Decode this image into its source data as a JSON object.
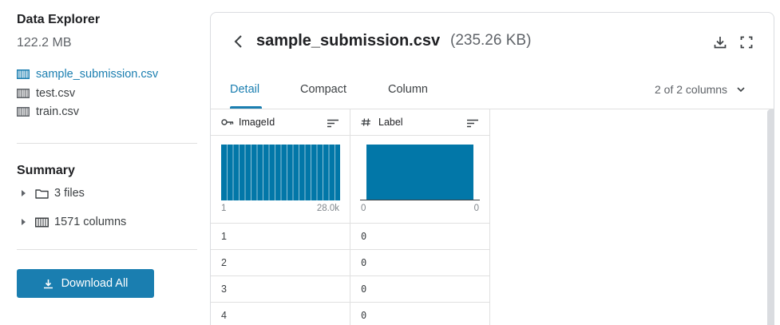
{
  "sidebar": {
    "title": "Data Explorer",
    "size": "122.2 MB",
    "files": [
      {
        "name": "sample_submission.csv",
        "active": true
      },
      {
        "name": "test.csv",
        "active": false
      },
      {
        "name": "train.csv",
        "active": false
      }
    ],
    "summary": {
      "title": "Summary",
      "items": [
        {
          "label": "3 files",
          "icon": "folder-icon"
        },
        {
          "label": "1571 columns",
          "icon": "table-icon"
        }
      ]
    },
    "download_all_label": "Download All"
  },
  "panel": {
    "file_title": "sample_submission.csv",
    "file_size": "(235.26 KB)",
    "tabs": [
      {
        "label": "Detail",
        "active": true
      },
      {
        "label": "Compact",
        "active": false
      },
      {
        "label": "Column",
        "active": false
      }
    ],
    "column_count": "2 of 2 columns",
    "columns": [
      {
        "name": "ImageId",
        "type_icon": "key-icon",
        "hist_min": "1",
        "hist_max": "28.0k",
        "rows": [
          "1",
          "2",
          "3",
          "4"
        ]
      },
      {
        "name": "Label",
        "type_icon": "hash-icon",
        "hist_min": "0",
        "hist_max": "0",
        "rows": [
          "0",
          "0",
          "0",
          "0"
        ]
      }
    ]
  },
  "colors": {
    "accent": "#1a7eb0",
    "histogram": "#0277a8"
  }
}
